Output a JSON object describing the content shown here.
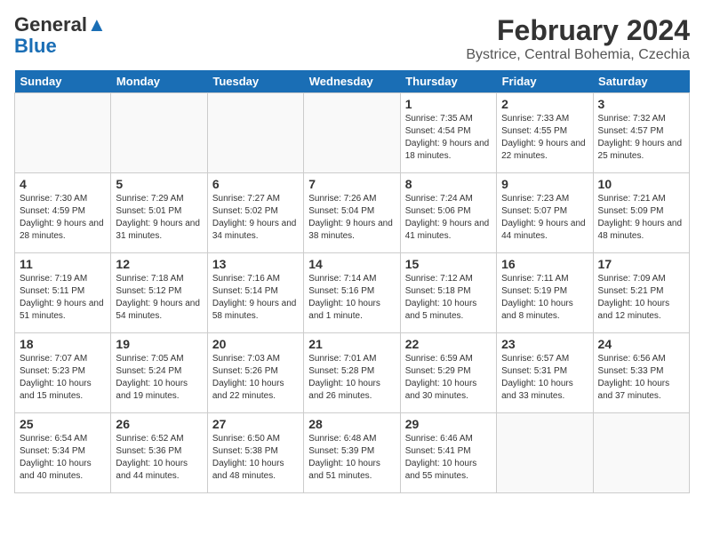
{
  "logo": {
    "general": "General",
    "blue": "Blue"
  },
  "header": {
    "title": "February 2024",
    "subtitle": "Bystrice, Central Bohemia, Czechia"
  },
  "weekdays": [
    "Sunday",
    "Monday",
    "Tuesday",
    "Wednesday",
    "Thursday",
    "Friday",
    "Saturday"
  ],
  "weeks": [
    [
      {
        "day": "",
        "info": ""
      },
      {
        "day": "",
        "info": ""
      },
      {
        "day": "",
        "info": ""
      },
      {
        "day": "",
        "info": ""
      },
      {
        "day": "1",
        "info": "Sunrise: 7:35 AM\nSunset: 4:54 PM\nDaylight: 9 hours\nand 18 minutes."
      },
      {
        "day": "2",
        "info": "Sunrise: 7:33 AM\nSunset: 4:55 PM\nDaylight: 9 hours\nand 22 minutes."
      },
      {
        "day": "3",
        "info": "Sunrise: 7:32 AM\nSunset: 4:57 PM\nDaylight: 9 hours\nand 25 minutes."
      }
    ],
    [
      {
        "day": "4",
        "info": "Sunrise: 7:30 AM\nSunset: 4:59 PM\nDaylight: 9 hours\nand 28 minutes."
      },
      {
        "day": "5",
        "info": "Sunrise: 7:29 AM\nSunset: 5:01 PM\nDaylight: 9 hours\nand 31 minutes."
      },
      {
        "day": "6",
        "info": "Sunrise: 7:27 AM\nSunset: 5:02 PM\nDaylight: 9 hours\nand 34 minutes."
      },
      {
        "day": "7",
        "info": "Sunrise: 7:26 AM\nSunset: 5:04 PM\nDaylight: 9 hours\nand 38 minutes."
      },
      {
        "day": "8",
        "info": "Sunrise: 7:24 AM\nSunset: 5:06 PM\nDaylight: 9 hours\nand 41 minutes."
      },
      {
        "day": "9",
        "info": "Sunrise: 7:23 AM\nSunset: 5:07 PM\nDaylight: 9 hours\nand 44 minutes."
      },
      {
        "day": "10",
        "info": "Sunrise: 7:21 AM\nSunset: 5:09 PM\nDaylight: 9 hours\nand 48 minutes."
      }
    ],
    [
      {
        "day": "11",
        "info": "Sunrise: 7:19 AM\nSunset: 5:11 PM\nDaylight: 9 hours\nand 51 minutes."
      },
      {
        "day": "12",
        "info": "Sunrise: 7:18 AM\nSunset: 5:12 PM\nDaylight: 9 hours\nand 54 minutes."
      },
      {
        "day": "13",
        "info": "Sunrise: 7:16 AM\nSunset: 5:14 PM\nDaylight: 9 hours\nand 58 minutes."
      },
      {
        "day": "14",
        "info": "Sunrise: 7:14 AM\nSunset: 5:16 PM\nDaylight: 10 hours\nand 1 minute."
      },
      {
        "day": "15",
        "info": "Sunrise: 7:12 AM\nSunset: 5:18 PM\nDaylight: 10 hours\nand 5 minutes."
      },
      {
        "day": "16",
        "info": "Sunrise: 7:11 AM\nSunset: 5:19 PM\nDaylight: 10 hours\nand 8 minutes."
      },
      {
        "day": "17",
        "info": "Sunrise: 7:09 AM\nSunset: 5:21 PM\nDaylight: 10 hours\nand 12 minutes."
      }
    ],
    [
      {
        "day": "18",
        "info": "Sunrise: 7:07 AM\nSunset: 5:23 PM\nDaylight: 10 hours\nand 15 minutes."
      },
      {
        "day": "19",
        "info": "Sunrise: 7:05 AM\nSunset: 5:24 PM\nDaylight: 10 hours\nand 19 minutes."
      },
      {
        "day": "20",
        "info": "Sunrise: 7:03 AM\nSunset: 5:26 PM\nDaylight: 10 hours\nand 22 minutes."
      },
      {
        "day": "21",
        "info": "Sunrise: 7:01 AM\nSunset: 5:28 PM\nDaylight: 10 hours\nand 26 minutes."
      },
      {
        "day": "22",
        "info": "Sunrise: 6:59 AM\nSunset: 5:29 PM\nDaylight: 10 hours\nand 30 minutes."
      },
      {
        "day": "23",
        "info": "Sunrise: 6:57 AM\nSunset: 5:31 PM\nDaylight: 10 hours\nand 33 minutes."
      },
      {
        "day": "24",
        "info": "Sunrise: 6:56 AM\nSunset: 5:33 PM\nDaylight: 10 hours\nand 37 minutes."
      }
    ],
    [
      {
        "day": "25",
        "info": "Sunrise: 6:54 AM\nSunset: 5:34 PM\nDaylight: 10 hours\nand 40 minutes."
      },
      {
        "day": "26",
        "info": "Sunrise: 6:52 AM\nSunset: 5:36 PM\nDaylight: 10 hours\nand 44 minutes."
      },
      {
        "day": "27",
        "info": "Sunrise: 6:50 AM\nSunset: 5:38 PM\nDaylight: 10 hours\nand 48 minutes."
      },
      {
        "day": "28",
        "info": "Sunrise: 6:48 AM\nSunset: 5:39 PM\nDaylight: 10 hours\nand 51 minutes."
      },
      {
        "day": "29",
        "info": "Sunrise: 6:46 AM\nSunset: 5:41 PM\nDaylight: 10 hours\nand 55 minutes."
      },
      {
        "day": "",
        "info": ""
      },
      {
        "day": "",
        "info": ""
      }
    ]
  ]
}
